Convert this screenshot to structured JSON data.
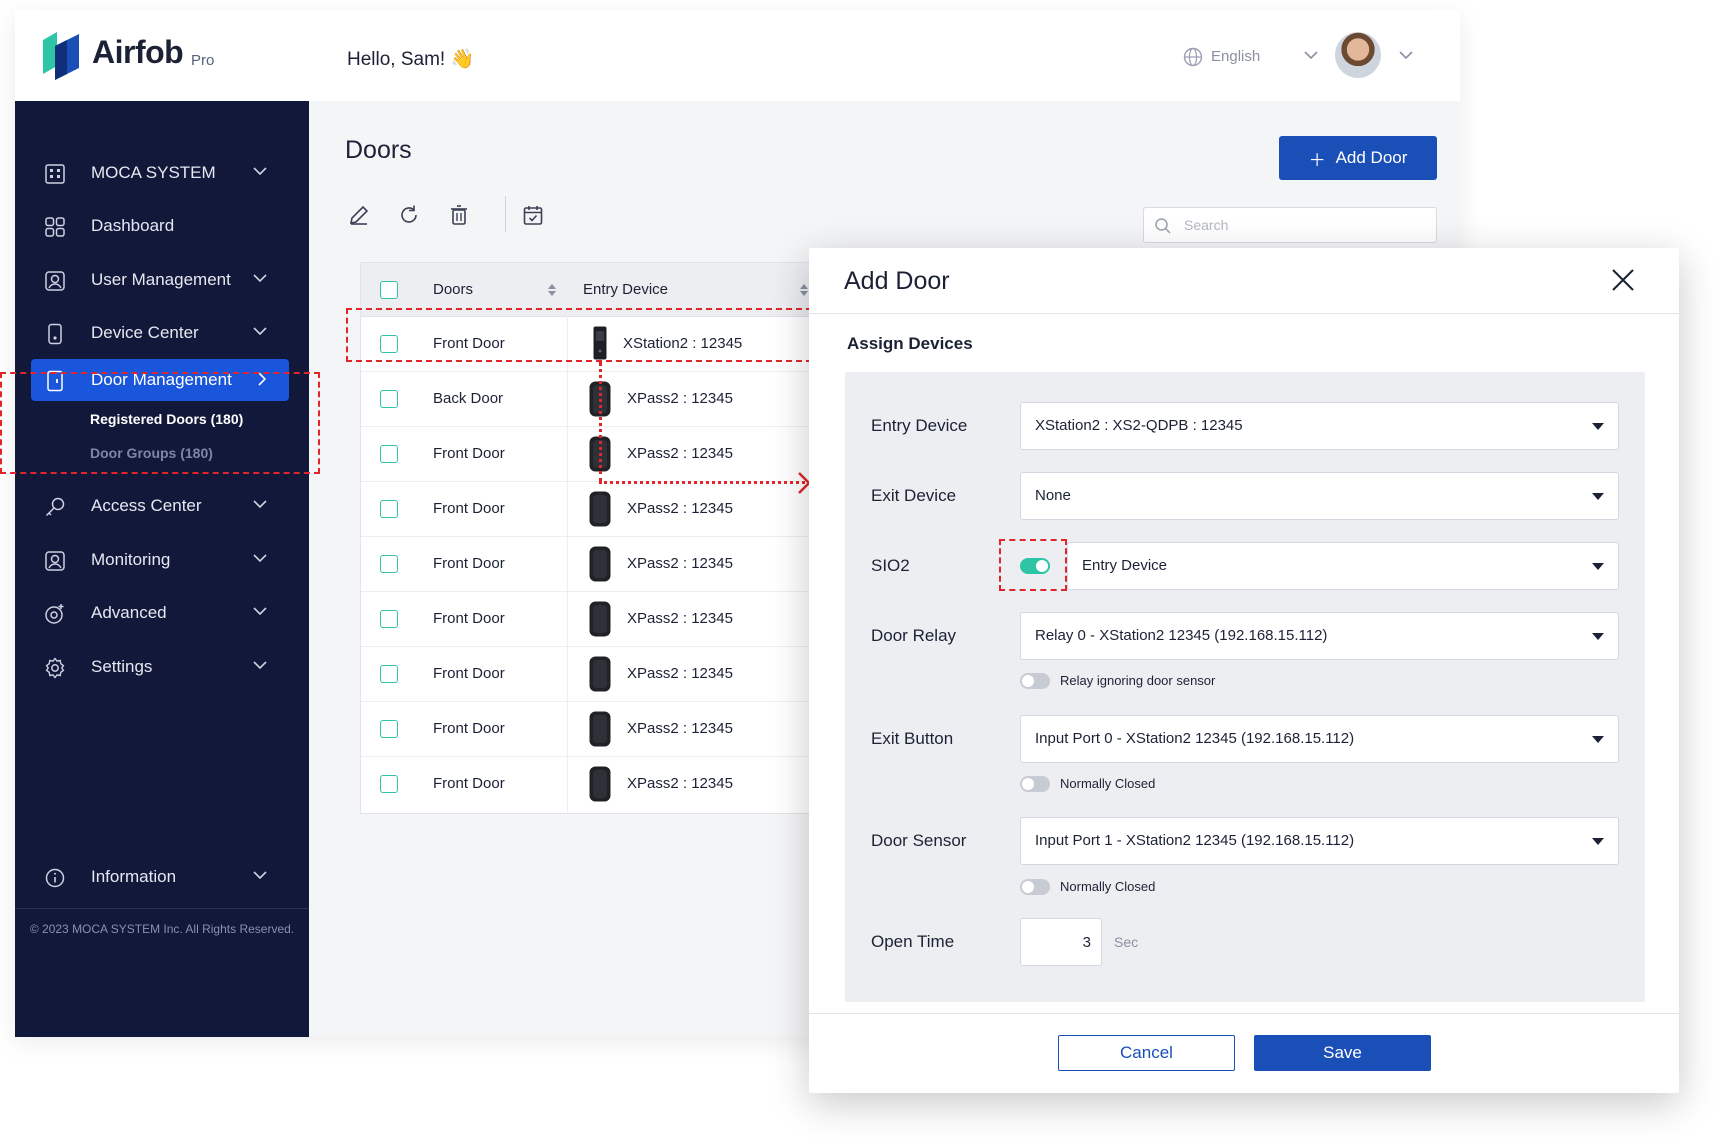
{
  "app": {
    "brand": "Airfob",
    "brand_suffix": "Pro",
    "greeting": "Hello, Sam! 👋"
  },
  "header": {
    "language": "English"
  },
  "sidebar": {
    "items": [
      {
        "label": "MOCA SYSTEM",
        "icon": "building-icon"
      },
      {
        "label": "Dashboard",
        "icon": "grid-icon"
      },
      {
        "label": "User Management",
        "icon": "user-icon"
      },
      {
        "label": "Device Center",
        "icon": "device-icon"
      },
      {
        "label": "Door Management",
        "icon": "door-icon"
      },
      {
        "label": "Access Center",
        "icon": "key-icon"
      },
      {
        "label": "Monitoring",
        "icon": "monitor-icon"
      },
      {
        "label": "Advanced",
        "icon": "advanced-icon"
      },
      {
        "label": "Settings",
        "icon": "gear-icon"
      },
      {
        "label": "Information",
        "icon": "info-icon"
      }
    ],
    "subitems": [
      {
        "label": "Registered Doors  (180)"
      },
      {
        "label": "Door Groups  (180)"
      }
    ],
    "footer": "© 2023 MOCA SYSTEM Inc. All Rights Reserved."
  },
  "page": {
    "title": "Doors",
    "add_button": "Add Door",
    "search_placeholder": "Search"
  },
  "table": {
    "columns": [
      "Doors",
      "Entry Device"
    ],
    "rows": [
      {
        "door": "Front Door",
        "device": "XStation2 : 12345"
      },
      {
        "door": "Back Door",
        "device": "XPass2 : 12345"
      },
      {
        "door": "Front Door",
        "device": "XPass2 : 12345"
      },
      {
        "door": "Front Door",
        "device": "XPass2 : 12345"
      },
      {
        "door": "Front Door",
        "device": "XPass2 : 12345"
      },
      {
        "door": "Front Door",
        "device": "XPass2 : 12345"
      },
      {
        "door": "Front Door",
        "device": "XPass2 : 12345"
      },
      {
        "door": "Front Door",
        "device": "XPass2 : 12345"
      },
      {
        "door": "Front Door",
        "device": "XPass2 : 12345"
      }
    ]
  },
  "modal": {
    "title": "Add Door",
    "section": "Assign Devices",
    "fields": {
      "entry_device": {
        "label": "Entry Device",
        "value": "XStation2 : XS2-QDPB : 12345"
      },
      "exit_device": {
        "label": "Exit Device",
        "value": "None"
      },
      "sio2": {
        "label": "SIO2",
        "value": "Entry Device",
        "toggle_on": true
      },
      "door_relay": {
        "label": "Door Relay",
        "value": "Relay 0 - XStation2 12345 (192.168.15.112)",
        "toggle_label": "Relay ignoring door sensor"
      },
      "exit_button": {
        "label": "Exit Button",
        "value": "Input Port 0 - XStation2 12345 (192.168.15.112)",
        "toggle_label": "Normally Closed"
      },
      "door_sensor": {
        "label": "Door Sensor",
        "value": "Input Port 1 - XStation2 12345 (192.168.15.112)",
        "toggle_label": "Normally Closed"
      },
      "open_time": {
        "label": "Open Time",
        "value": "3",
        "unit": "Sec"
      }
    },
    "cancel": "Cancel",
    "save": "Save"
  },
  "colors": {
    "sidebar_bg": "#12183a",
    "accent": "#1a4fb8",
    "toggle_on": "#2ec4a6",
    "annotation": "#e0262b"
  }
}
